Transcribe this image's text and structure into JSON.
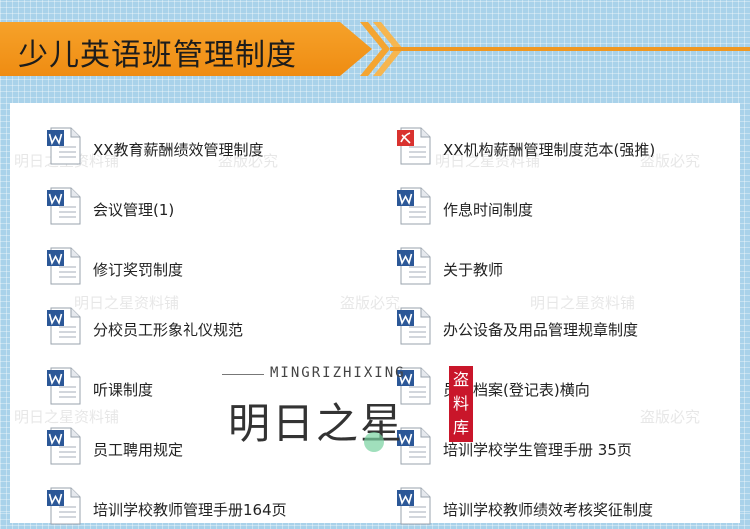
{
  "header": {
    "title": "少儿英语班管理制度"
  },
  "documents": [
    {
      "label": "XX教育薪酬绩效管理制度",
      "icon": "word-doc-icon"
    },
    {
      "label": "XX机构薪酬管理制度范本(强推)",
      "icon": "pdf-doc-icon"
    },
    {
      "label": "会议管理(1)",
      "icon": "word-doc-icon"
    },
    {
      "label": "作息时间制度",
      "icon": "word-doc-icon"
    },
    {
      "label": "修订奖罚制度",
      "icon": "word-doc-icon"
    },
    {
      "label": "关于教师",
      "icon": "word-doc-icon"
    },
    {
      "label": "分校员工形象礼仪规范",
      "icon": "word-doc-icon"
    },
    {
      "label": "办公设备及用品管理规章制度",
      "icon": "word-doc-icon"
    },
    {
      "label": "听课制度",
      "icon": "word-doc-icon"
    },
    {
      "label": "员工档案(登记表)横向",
      "icon": "word-doc-icon"
    },
    {
      "label": "员工聘用规定",
      "icon": "word-doc-icon"
    },
    {
      "label": "培训学校学生管理手册 35页",
      "icon": "word-doc-icon"
    },
    {
      "label": "培训学校教师管理手册164页",
      "icon": "word-doc-icon"
    },
    {
      "label": "培训学校教师绩效考核奖征制度",
      "icon": "word-doc-icon"
    }
  ],
  "watermarks": {
    "brand": "明日之星资料铺",
    "piracy": "盗版必究"
  },
  "logo": {
    "subtitle": "MINGRIZHIXING",
    "main": "明日之星",
    "seal": "盗料库"
  },
  "colors": {
    "banner": "#f39a1e",
    "background": "#a9d2ea",
    "word_icon": "#2b5797",
    "pdf_icon": "#d9322f",
    "seal": "#c9162a"
  }
}
